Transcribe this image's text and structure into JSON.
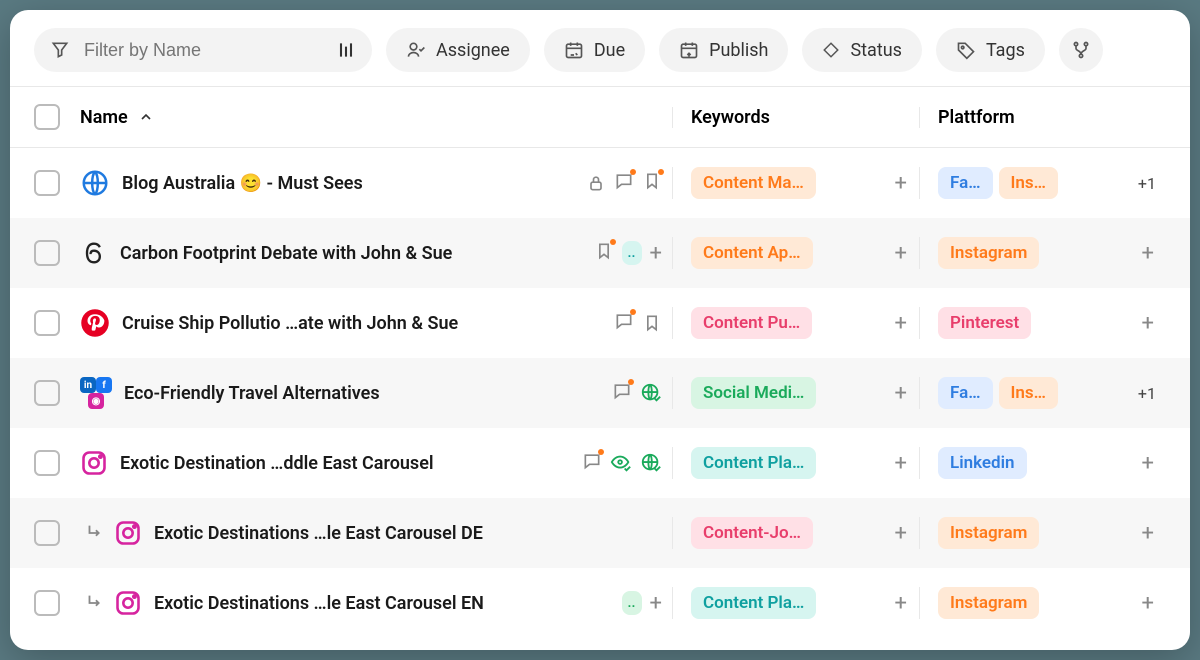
{
  "toolbar": {
    "filter_placeholder": "Filter by Name",
    "assignee": "Assignee",
    "due": "Due",
    "publish": "Publish",
    "status": "Status",
    "tags": "Tags"
  },
  "header": {
    "name": "Name",
    "keywords": "Keywords",
    "platform": "Plattform"
  },
  "rows": [
    {
      "title": "Blog Australia 😊 - Must Sees",
      "keyword": "Content Ma…",
      "kw_class": "tag-orange",
      "platforms": [
        {
          "label": "Fa…",
          "class": "tag-blue"
        },
        {
          "label": "Ins…",
          "class": "tag-orange"
        }
      ],
      "overflow": "+1"
    },
    {
      "title": "Carbon Footprint Debate with John & Sue",
      "keyword": "Content Ap…",
      "kw_class": "tag-orange",
      "platforms": [
        {
          "label": "Instagram",
          "class": "tag-orange"
        }
      ]
    },
    {
      "title": "Cruise Ship Pollutio  …ate with John & Sue",
      "keyword": "Content Pu…",
      "kw_class": "tag-red",
      "platforms": [
        {
          "label": "Pinterest",
          "class": "tag-red"
        }
      ]
    },
    {
      "title": "Eco-Friendly Travel Alternatives",
      "keyword": "Social Medi…",
      "kw_class": "tag-green",
      "platforms": [
        {
          "label": "Fa…",
          "class": "tag-blue"
        },
        {
          "label": "Ins…",
          "class": "tag-orange"
        }
      ],
      "overflow": "+1"
    },
    {
      "title": "Exotic Destination …ddle East Carousel",
      "keyword": "Content Pla…",
      "kw_class": "tag-teal",
      "platforms": [
        {
          "label": "Linkedin",
          "class": "tag-blue"
        }
      ]
    },
    {
      "title": "Exotic Destinations    …le East Carousel DE",
      "keyword": "Content-Jo…",
      "kw_class": "tag-red",
      "platforms": [
        {
          "label": "Instagram",
          "class": "tag-orange"
        }
      ],
      "child": true
    },
    {
      "title": "Exotic Destinations    …le East Carousel EN",
      "keyword": "Content Pla…",
      "kw_class": "tag-teal",
      "platforms": [
        {
          "label": "Instagram",
          "class": "tag-orange"
        }
      ],
      "child": true
    }
  ]
}
